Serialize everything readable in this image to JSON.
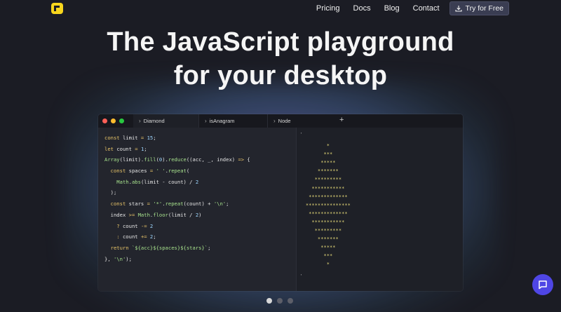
{
  "nav": {
    "links": [
      "Pricing",
      "Docs",
      "Blog",
      "Contact"
    ],
    "cta_label": "Try for Free"
  },
  "hero": {
    "line1": "The JavaScript playground",
    "line2": "for your desktop"
  },
  "window": {
    "tabs": [
      "Diamond",
      "isAnagram",
      "Node"
    ],
    "new_tab": "+",
    "traffic_lights": [
      "#ff5f57",
      "#febc2e",
      "#28c840"
    ],
    "code_lines": [
      [
        {
          "t": "const ",
          "c": "kw"
        },
        {
          "t": "limit",
          "c": "var"
        },
        {
          "t": " = ",
          "c": "kw"
        },
        {
          "t": "15",
          "c": "num"
        },
        {
          "t": ";",
          "c": "var"
        }
      ],
      [
        {
          "t": "let ",
          "c": "kw"
        },
        {
          "t": "count",
          "c": "var"
        },
        {
          "t": " = ",
          "c": "kw"
        },
        {
          "t": "1",
          "c": "num"
        },
        {
          "t": ";",
          "c": "var"
        }
      ],
      [
        {
          "t": "Array",
          "c": "fn"
        },
        {
          "t": "(limit).",
          "c": "var"
        },
        {
          "t": "fill",
          "c": "fn"
        },
        {
          "t": "(",
          "c": "var"
        },
        {
          "t": "0",
          "c": "num"
        },
        {
          "t": ").",
          "c": "var"
        },
        {
          "t": "reduce",
          "c": "fn"
        },
        {
          "t": "((acc, _, index) ",
          "c": "var"
        },
        {
          "t": "=>",
          "c": "kw"
        },
        {
          "t": " {",
          "c": "var"
        }
      ],
      [
        {
          "t": "  const ",
          "c": "kw"
        },
        {
          "t": "spaces",
          "c": "var"
        },
        {
          "t": " = ",
          "c": "kw"
        },
        {
          "t": "' '",
          "c": "str"
        },
        {
          "t": ".",
          "c": "var"
        },
        {
          "t": "repeat",
          "c": "fn"
        },
        {
          "t": "(",
          "c": "var"
        }
      ],
      [
        {
          "t": "    Math",
          "c": "fn"
        },
        {
          "t": ".",
          "c": "var"
        },
        {
          "t": "abs",
          "c": "fn"
        },
        {
          "t": "(limit - count) / ",
          "c": "var"
        },
        {
          "t": "2",
          "c": "num"
        }
      ],
      [
        {
          "t": "  );",
          "c": "var"
        }
      ],
      [
        {
          "t": "  const ",
          "c": "kw"
        },
        {
          "t": "stars",
          "c": "var"
        },
        {
          "t": " = ",
          "c": "kw"
        },
        {
          "t": "'*'",
          "c": "str"
        },
        {
          "t": ".",
          "c": "var"
        },
        {
          "t": "repeat",
          "c": "fn"
        },
        {
          "t": "(count) + ",
          "c": "var"
        },
        {
          "t": "'\\n'",
          "c": "str"
        },
        {
          "t": ";",
          "c": "var"
        }
      ],
      [
        {
          "t": "  index ",
          "c": "var"
        },
        {
          "t": ">=",
          "c": "kw"
        },
        {
          "t": " Math",
          "c": "fn"
        },
        {
          "t": ".",
          "c": "var"
        },
        {
          "t": "floor",
          "c": "fn"
        },
        {
          "t": "(limit / ",
          "c": "var"
        },
        {
          "t": "2",
          "c": "num"
        },
        {
          "t": ")",
          "c": "var"
        }
      ],
      [
        {
          "t": "    ? ",
          "c": "kw"
        },
        {
          "t": "count ",
          "c": "var"
        },
        {
          "t": "-=",
          "c": "kw"
        },
        {
          "t": " 2",
          "c": "num"
        }
      ],
      [
        {
          "t": "    : ",
          "c": "kw"
        },
        {
          "t": "count ",
          "c": "var"
        },
        {
          "t": "+=",
          "c": "kw"
        },
        {
          "t": " 2",
          "c": "num"
        },
        {
          "t": ";",
          "c": "var"
        }
      ],
      [
        {
          "t": "  return ",
          "c": "kw"
        },
        {
          "t": "`${acc}${spaces}${stars}`",
          "c": "str"
        },
        {
          "t": ";",
          "c": "var"
        }
      ],
      [
        {
          "t": "}, ",
          "c": "var"
        },
        {
          "t": "'\\n'",
          "c": "str"
        },
        {
          "t": ");",
          "c": "var"
        }
      ]
    ],
    "output_open_quote": "'",
    "output_close_quote": "'",
    "output_lines": [
      "*",
      "***",
      "*****",
      "*******",
      "*********",
      "***********",
      "*************",
      "***************",
      "*************",
      "***********",
      "*********",
      "*******",
      "*****",
      "***",
      "*"
    ]
  },
  "carousel": {
    "count": 3,
    "active": 0
  }
}
